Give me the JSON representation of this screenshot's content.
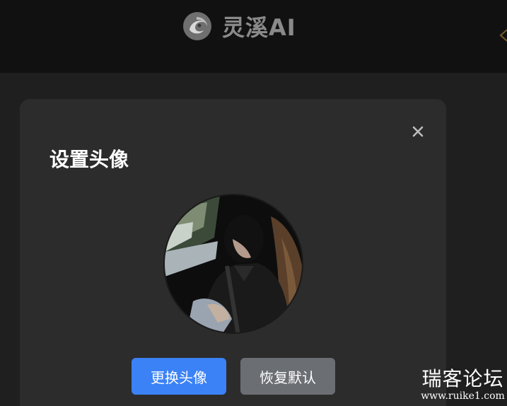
{
  "header": {
    "brand_name": "灵溪AI",
    "logo_icon": "swirl-logo-icon"
  },
  "modal": {
    "title": "设置头像",
    "close_icon": "close-icon",
    "avatar_icon": "user-avatar-photo",
    "buttons": {
      "change_label": "更换头像",
      "reset_label": "恢复默认"
    }
  },
  "watermark": {
    "main": "瑞客论坛",
    "url": "www.ruike1.com"
  },
  "colors": {
    "primary": "#3b82f6",
    "secondary": "#6b6e73",
    "modal_bg": "#2c2c2c",
    "page_bg": "#1f1f1f",
    "header_bg": "#111111"
  }
}
